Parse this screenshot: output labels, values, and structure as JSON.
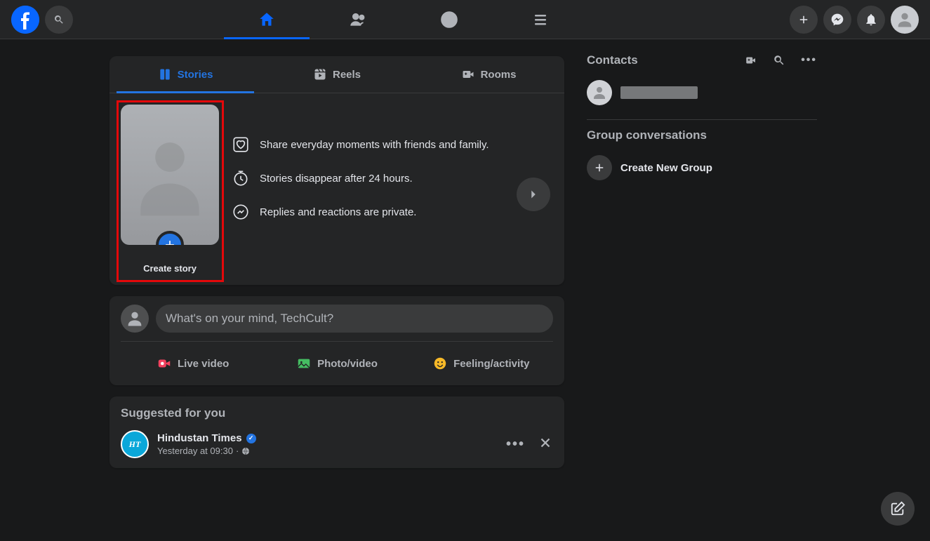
{
  "header": {
    "nav": [
      "Home",
      "Friends",
      "Groups",
      "Menu"
    ]
  },
  "stories": {
    "tabs": {
      "stories": "Stories",
      "reels": "Reels",
      "rooms": "Rooms"
    },
    "create_label": "Create story",
    "info": [
      "Share everyday moments with friends and family.",
      "Stories disappear after 24 hours.",
      "Replies and reactions are private."
    ]
  },
  "composer": {
    "placeholder": "What's on your mind, TechCult?",
    "actions": {
      "live": "Live video",
      "photo": "Photo/video",
      "feeling": "Feeling/activity"
    }
  },
  "suggested": {
    "title": "Suggested for you",
    "item": {
      "name": "Hindustan Times",
      "time": "Yesterday at 09:30",
      "avatar_text": "HT"
    }
  },
  "sidebar": {
    "contacts_title": "Contacts",
    "groups_title": "Group conversations",
    "create_group": "Create New Group"
  }
}
